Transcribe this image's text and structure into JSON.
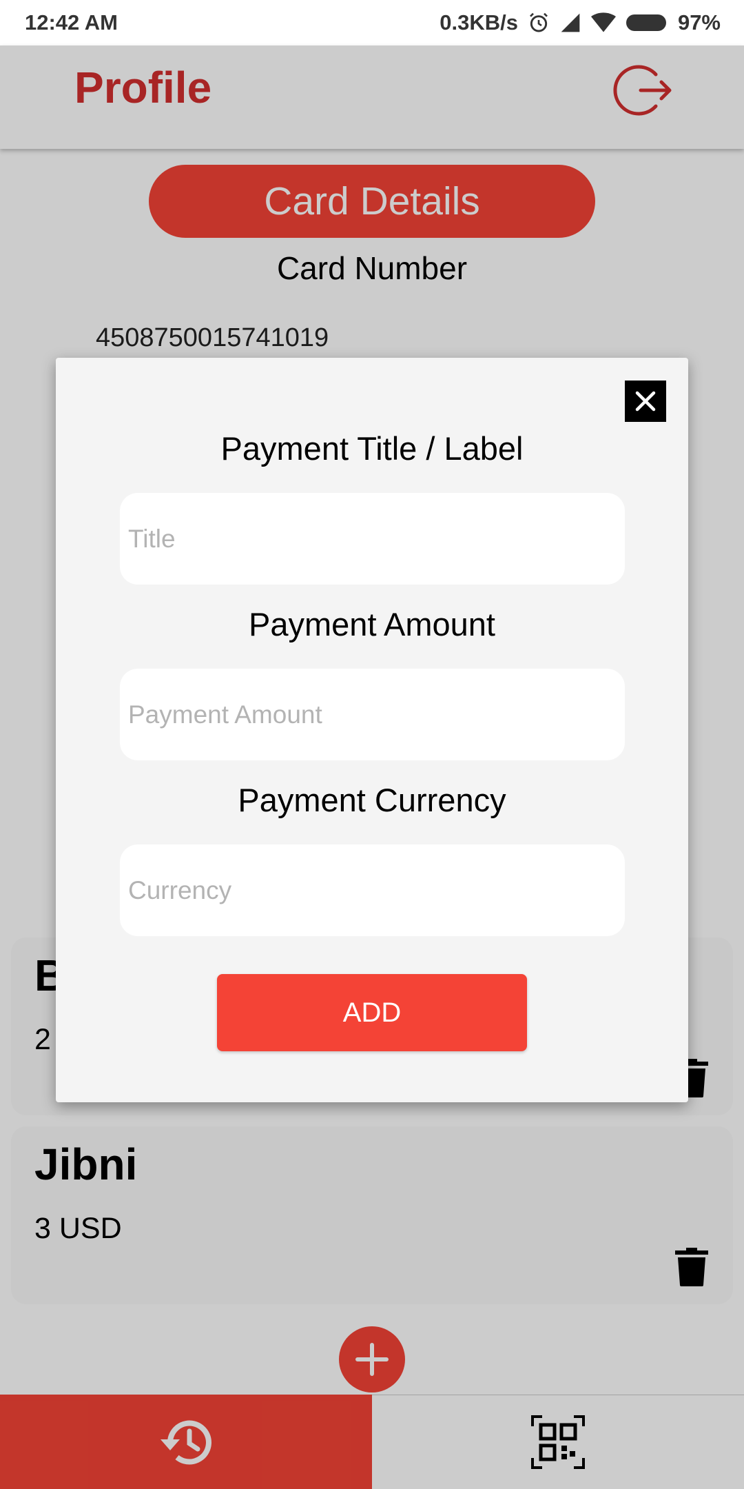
{
  "status_bar": {
    "time": "12:42 AM",
    "network_speed": "0.3KB/s",
    "battery": "97%",
    "icons": [
      "alarm-icon",
      "signal-icon",
      "wifi-icon",
      "battery-icon"
    ]
  },
  "header": {
    "title": "Profile",
    "logout_icon": "logout-icon"
  },
  "card": {
    "section_title": "Card Details",
    "number_label": "Card Number",
    "number_value": "4508750015741019"
  },
  "payments": [
    {
      "title": "B",
      "amount": "2"
    },
    {
      "title": "Jibni",
      "amount": "3 USD"
    }
  ],
  "modal": {
    "title_label": "Payment Title / Label",
    "title_placeholder": "Title",
    "amount_label": "Payment Amount",
    "amount_placeholder": "Payment Amount",
    "currency_label": "Payment Currency",
    "currency_placeholder": "Currency",
    "add_button": "ADD",
    "close_icon": "close-icon"
  },
  "bottom_nav": {
    "items": [
      "history-icon",
      "qr-code-icon"
    ],
    "active": "history-icon"
  },
  "colors": {
    "accent": "#f44336",
    "header_title": "#d32f2f",
    "modal_bg": "#f4f4f4"
  }
}
